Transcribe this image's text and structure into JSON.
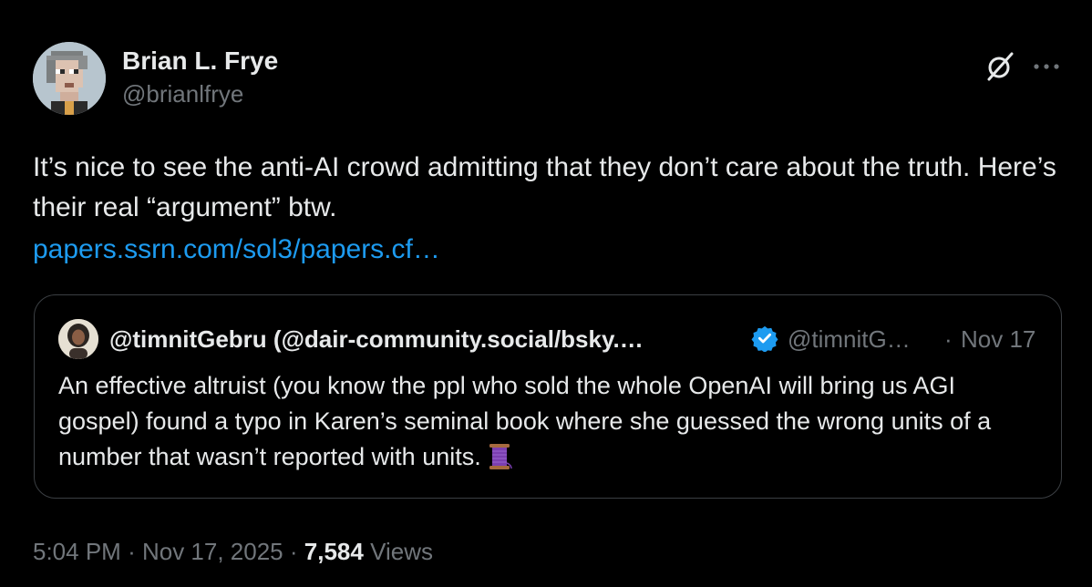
{
  "author": {
    "name": "Brian L. Frye",
    "handle": "@brianlfrye"
  },
  "header_icons": {
    "grok": "grok-slash-icon",
    "more": "more-horizontal-icon"
  },
  "tweet": {
    "text": "It’s nice to see the anti-AI crowd admitting that they don’t care about the truth. Here’s their real “argument” btw.",
    "link": "papers.ssrn.com/sol3/papers.cf…"
  },
  "quote": {
    "name": "@timnitGebru (@dair-community.social/bsky.…",
    "verified": true,
    "handle": "@timnitG…",
    "separator": "·",
    "date": "Nov 17",
    "text": "An effective altruist (you know the ppl who sold the whole OpenAI will bring us AGI gospel) found a typo in Karen’s seminal book where she guessed the wrong units of a number that wasn’t reported with units.",
    "emoji": "thread-spool-icon"
  },
  "meta": {
    "time": "5:04 PM",
    "sep1": "·",
    "date": "Nov 17, 2025",
    "sep2": "·",
    "views_count": "7,584",
    "views_label": "Views"
  },
  "colors": {
    "background": "#000000",
    "text_primary": "#e7e9ea",
    "text_secondary": "#71767b",
    "link": "#1d9bf0",
    "verified": "#1d9bf0",
    "border": "#3b3f43"
  }
}
